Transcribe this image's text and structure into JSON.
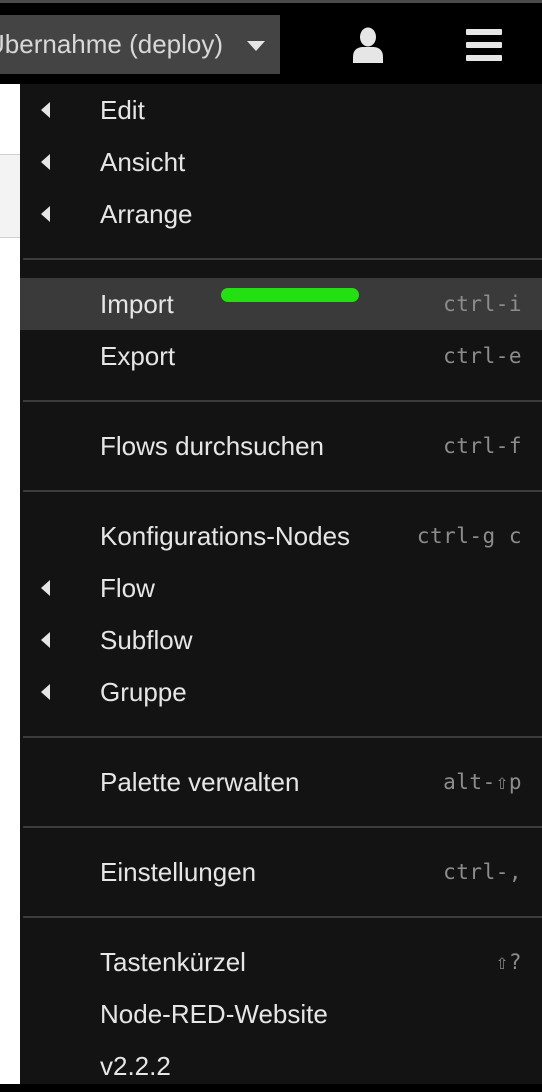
{
  "header": {
    "deploy_label": "Übernahme (deploy)",
    "icons": {
      "deploy_caret": "caret-down-icon",
      "user": "user-icon",
      "menu": "hamburger-menu-icon"
    }
  },
  "menu": {
    "edit": {
      "label": "Edit"
    },
    "view": {
      "label": "Ansicht"
    },
    "arrange": {
      "label": "Arrange"
    },
    "import": {
      "label": "Import",
      "shortcut": "ctrl-i"
    },
    "export": {
      "label": "Export",
      "shortcut": "ctrl-e"
    },
    "search": {
      "label": "Flows durchsuchen",
      "shortcut": "ctrl-f"
    },
    "config_nodes": {
      "label": "Konfigurations-Nodes",
      "shortcut": "ctrl-g c"
    },
    "flow": {
      "label": "Flow"
    },
    "subflow": {
      "label": "Subflow"
    },
    "group": {
      "label": "Gruppe"
    },
    "palette": {
      "label": "Palette verwalten",
      "shortcut": "alt-⇧p"
    },
    "settings": {
      "label": "Einstellungen",
      "shortcut": "ctrl-,"
    },
    "keyboard": {
      "label": "Tastenkürzel",
      "shortcut": "⇧?"
    },
    "website": {
      "label": "Node-RED-Website"
    },
    "version": {
      "label": "v2.2.2"
    }
  },
  "colors": {
    "menu_background": "#131313",
    "active_item": "#3a3a3a",
    "highlight_mark": "#22e012",
    "header": "#000000",
    "deploy_button": "#444444"
  }
}
